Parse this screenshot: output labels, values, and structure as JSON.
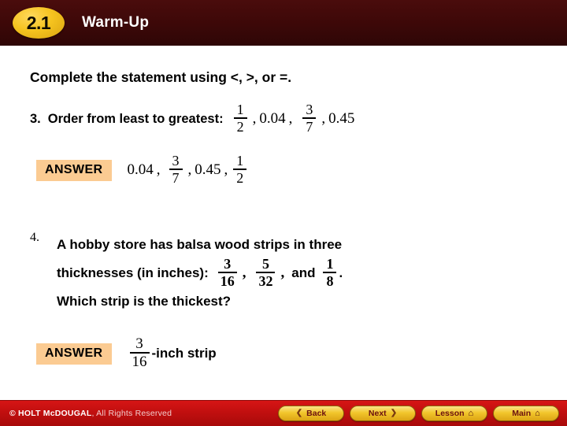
{
  "header": {
    "chapter_badge": "2.1",
    "title": "Warm-Up"
  },
  "slide": {
    "prompt": "Complete the statement using <, >, or =.",
    "questions": [
      {
        "number": "3.",
        "text": "Order from least to greatest:",
        "values": [
          "1/2",
          "0.04",
          "3/7",
          "0.45"
        ],
        "answer_label": "ANSWER",
        "answer_values": [
          "0.04",
          "3/7",
          "0.45",
          "1/2"
        ]
      },
      {
        "number": "4.",
        "line1": "A hobby store has balsa wood strips in three",
        "line2_pre": "thicknesses (in inches):",
        "line2_and": "and",
        "line2_period": ".",
        "line2_values": [
          "3/16",
          "5/32",
          "1/8"
        ],
        "line3": "Which strip is the thickest?",
        "answer_label": "ANSWER",
        "answer_fraction": "3/16",
        "answer_suffix": "-inch strip"
      }
    ],
    "fractions": {
      "half": {
        "num": "1",
        "den": "2"
      },
      "three_sevenths": {
        "num": "3",
        "den": "7"
      },
      "three_sixteenths": {
        "num": "3",
        "den": "16"
      },
      "five_thirtyseconds": {
        "num": "5",
        "den": "32"
      },
      "one_eighth": {
        "num": "1",
        "den": "8"
      }
    },
    "decimals": {
      "d004": "0.04",
      "d045": "0.45"
    },
    "separators": {
      "comma": ",",
      "colon": ":"
    }
  },
  "footer": {
    "copyright_mark": "© HOLT McDOUGAL",
    "copyright_rest": ", All Rights Reserved",
    "buttons": [
      {
        "label": "Back",
        "icon": "chevron-left-icon",
        "glyph": "❮"
      },
      {
        "label": "Next",
        "icon": "chevron-right-icon",
        "glyph": "❯"
      },
      {
        "label": "Lesson",
        "icon": "home-icon",
        "glyph": "⌂"
      },
      {
        "label": "Main",
        "icon": "home-icon",
        "glyph": "⌂"
      }
    ]
  },
  "colors": {
    "header_bg": "#3c0808",
    "badge_gold": "#f5c31f",
    "answer_box_bg": "#fbcb92",
    "footer_red": "#c10f0f",
    "button_gold": "#f2c62c"
  }
}
